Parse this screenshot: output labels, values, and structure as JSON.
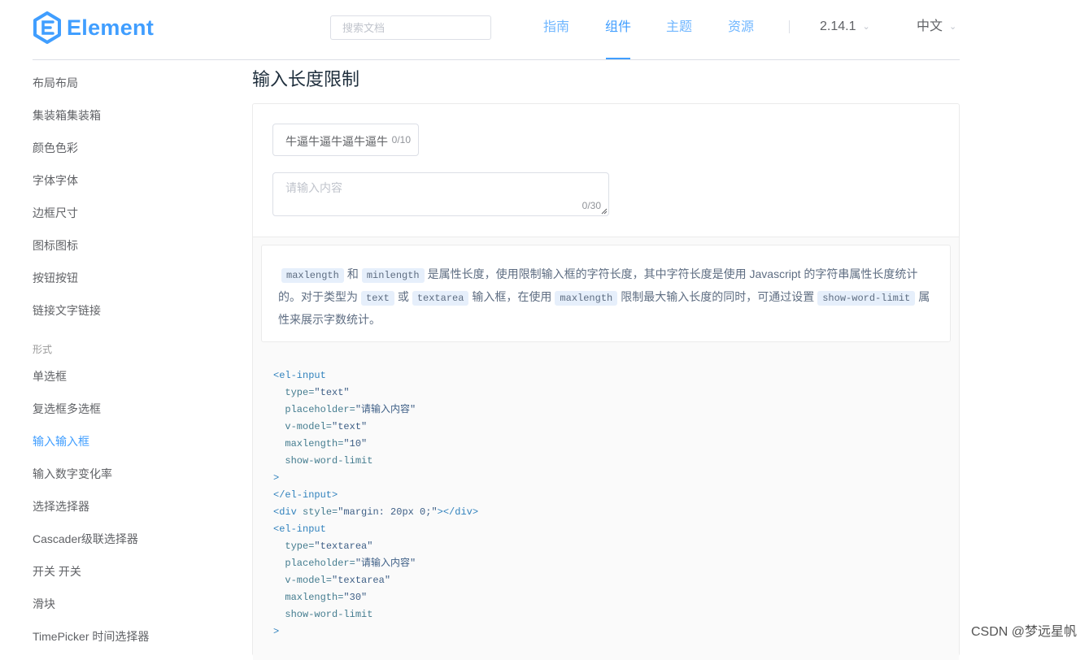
{
  "header": {
    "logo_text": "Element",
    "search_placeholder": "搜索文档",
    "nav": [
      "指南",
      "组件",
      "主题",
      "资源"
    ],
    "version": "2.14.1",
    "language": "中文",
    "accent_color": "#409eff"
  },
  "sidebar": {
    "items_top": [
      "布局布局",
      "集装箱集装箱",
      "颜色色彩",
      "字体字体",
      "边框尺寸",
      "图标图标",
      "按钮按钮",
      "链接文字链接"
    ],
    "group_label": "形式",
    "items_form": [
      "单选框",
      "复选框多选框",
      "输入输入框",
      "输入数字变化率",
      "选择选择器",
      "Cascader级联选择器",
      "开关 开关",
      "滑块",
      "TimePicker 时间选择器"
    ],
    "active": "输入输入框"
  },
  "main": {
    "title": "输入长度限制",
    "input1": {
      "value": "牛逼牛逼牛逼牛逼牛",
      "count": "0/10"
    },
    "textarea": {
      "placeholder": "请输入内容",
      "count": "0/30"
    },
    "desc": {
      "code1": "maxlength",
      "t1": "和",
      "code2": "minlength",
      "t2": "是属性长度，使用限制输入框的字符长度，其中字符长度是使用 Javascript 的字符串属性长度统计的。对于类型为",
      "code3": "text",
      "t3": "或",
      "code4": "textarea",
      "t4": "输入框，在使用",
      "code5": "maxlength",
      "t5": "限制最大输入长度的同时，可通过设置",
      "code6": "show-word-limit",
      "t6": "属性来展示字数统计。"
    },
    "code": {
      "l1": "<el-input",
      "l2a": "  type=",
      "l2b": "\"text\"",
      "l3a": "  placeholder=",
      "l3b": "\"请输入内容\"",
      "l4a": "  v-model=",
      "l4b": "\"text\"",
      "l5a": "  maxlength=",
      "l5b": "\"10\"",
      "l6": "  show-word-limit",
      "l7": ">",
      "l8": "</el-input>",
      "l9a": "<div ",
      "l9b": "style=",
      "l9c": "\"margin: 20px 0;\"",
      "l9d": "></div>",
      "l10": "<el-input",
      "l11a": "  type=",
      "l11b": "\"textarea\"",
      "l12a": "  placeholder=",
      "l12b": "\"请输入内容\"",
      "l13a": "  v-model=",
      "l13b": "\"textarea\"",
      "l14a": "  maxlength=",
      "l14b": "\"30\"",
      "l15": "  show-word-limit",
      "l16": ">"
    }
  },
  "watermark": "CSDN @梦远星帆"
}
